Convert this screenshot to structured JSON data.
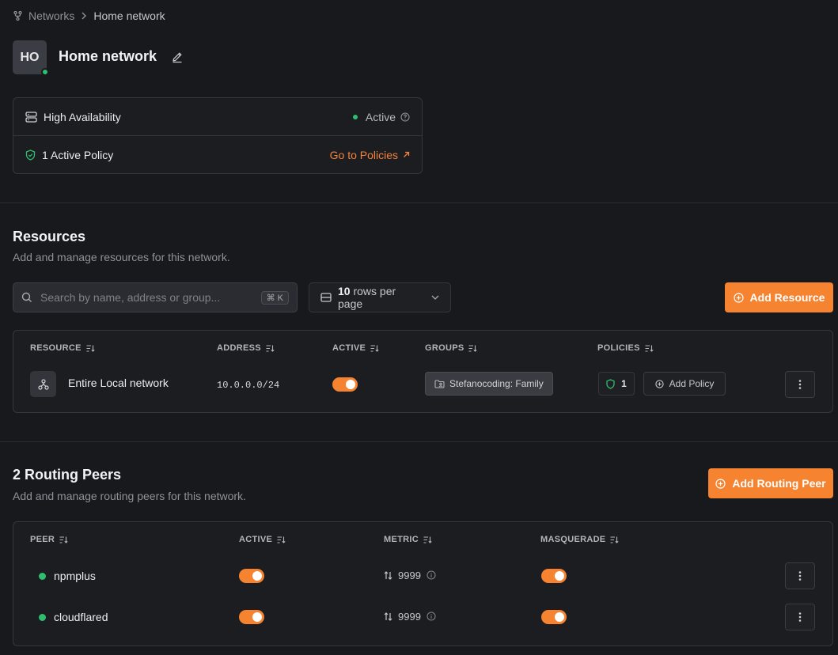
{
  "breadcrumb": {
    "parent": "Networks",
    "current": "Home network"
  },
  "header": {
    "avatar_initials": "HO",
    "title": "Home network"
  },
  "info": {
    "ha_label": "High Availability",
    "ha_status": "Active",
    "policy_label": "1 Active Policy",
    "policy_link": "Go to Policies"
  },
  "resources": {
    "title": "Resources",
    "subtitle": "Add and manage resources for this network.",
    "search_placeholder": "Search by name, address or group...",
    "search_shortcut": "⌘ K",
    "rows_count": "10",
    "rows_label": "rows per page",
    "add_button": "Add Resource",
    "columns": {
      "resource": "RESOURCE",
      "address": "ADDRESS",
      "active": "ACTIVE",
      "groups": "GROUPS",
      "policies": "POLICIES"
    },
    "rows": [
      {
        "name": "Entire Local network",
        "address": "10.0.0.0/24",
        "active": true,
        "group": "Stefanocoding: Family",
        "policy_count": "1",
        "add_policy": "Add Policy"
      }
    ]
  },
  "peers": {
    "title": "2 Routing Peers",
    "subtitle": "Add and manage routing peers for this network.",
    "add_button": "Add Routing Peer",
    "columns": {
      "peer": "PEER",
      "active": "ACTIVE",
      "metric": "METRIC",
      "masquerade": "MASQUERADE"
    },
    "rows": [
      {
        "name": "npmplus",
        "active": true,
        "metric": "9999",
        "masquerade": true
      },
      {
        "name": "cloudflared",
        "active": true,
        "metric": "9999",
        "masquerade": true
      }
    ]
  },
  "colors": {
    "accent": "#f68330",
    "status_green": "#2fbd6f",
    "background": "#18191c"
  }
}
